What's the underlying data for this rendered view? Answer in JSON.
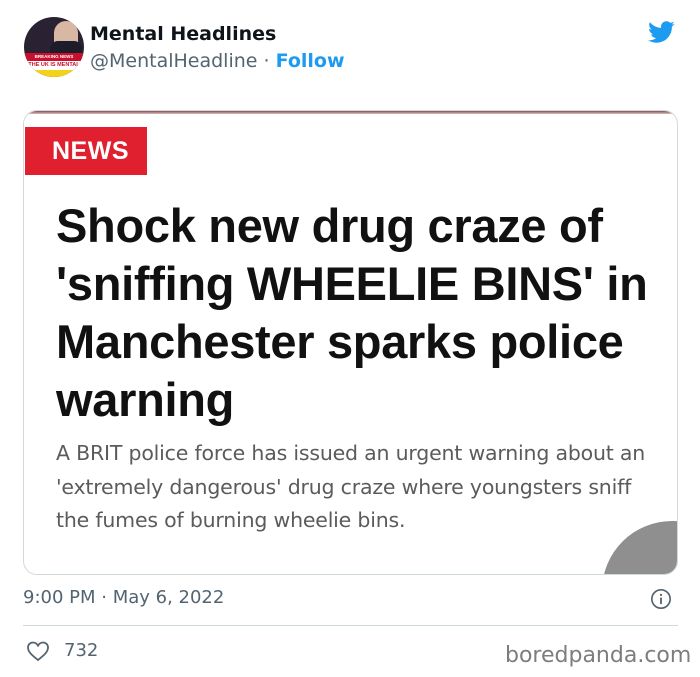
{
  "author": {
    "display_name": "Mental Headlines",
    "handle": "@MentalHeadline",
    "separator": "·",
    "follow_label": "Follow",
    "avatar": {
      "banner_top": "BREAKING NEWS",
      "banner_bottom": "THE UK IS MENTAL"
    }
  },
  "brand_icon": "twitter-bird-icon",
  "card": {
    "tag": "NEWS",
    "headline": "Shock new drug craze of 'sniffing WHEELIE BINS' in Manchester sparks police warning",
    "standfirst": "A BRIT police force has issued an urgent warning about an 'extremely dangerous' drug craze where youngsters sniff the fumes of burning wheelie bins."
  },
  "meta": {
    "timestamp": "9:00 PM · May 6, 2022",
    "info_icon": "info-icon"
  },
  "engagement": {
    "like_icon": "heart-icon",
    "like_count": "732"
  },
  "watermark": "boredpanda.com",
  "colors": {
    "accent": "#1d9bf0",
    "news_red": "#e0202e",
    "secondary_text": "#536471",
    "border": "#cfd9de"
  }
}
